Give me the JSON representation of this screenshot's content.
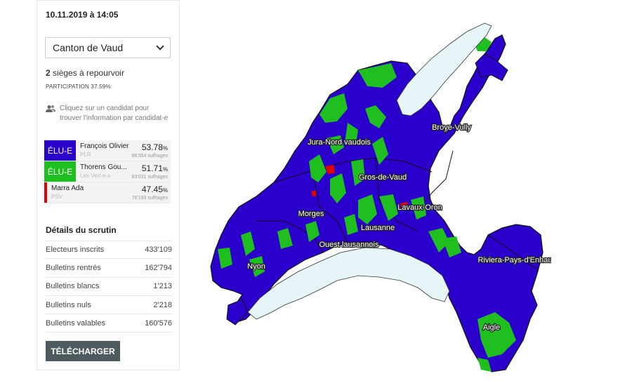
{
  "header": {
    "timestamp": "10.11.2019 à 14:05"
  },
  "selector": {
    "value": "Canton de Vaud"
  },
  "summary": {
    "seats_count": "2",
    "seats_text": " sièges à repourvoir",
    "participation": "PARTICIPATION 37.59%"
  },
  "hint": {
    "text": "Cliquez sur un candidat pour trouver l'information par candidat-e"
  },
  "candidates": [
    {
      "badge": "ÉLU-E",
      "name": "François Olivier",
      "party": "PLR",
      "pct": "53.78",
      "pct_unit": "%",
      "votes": "86'354 suffrages",
      "color": "#2b00cc"
    },
    {
      "badge": "ÉLU-E",
      "name": "Thorens Gou...",
      "party": "Les Vert-e-s",
      "pct": "51.71",
      "pct_unit": "%",
      "votes": "83'031 suffrages",
      "color": "#1fbf1f"
    },
    {
      "badge": "",
      "name": "Marra Ada",
      "party": "PSV",
      "pct": "47.45",
      "pct_unit": "%",
      "votes": "76'193 suffrages",
      "color": "#e00000"
    }
  ],
  "details": {
    "title": "Détails du scrutin",
    "rows": [
      {
        "label": "Electeurs inscrits",
        "value": "433'109"
      },
      {
        "label": "Bulletins rentrés",
        "value": "162'794"
      },
      {
        "label": "Bulletins blancs",
        "value": "1'213"
      },
      {
        "label": "Bulletins nuls",
        "value": "2'218"
      },
      {
        "label": "Bulletins valables",
        "value": "160'576"
      }
    ]
  },
  "download": {
    "label": "TÉLÉCHARGER"
  },
  "map": {
    "colors": {
      "plr": "#2b00cc",
      "verts": "#1fbf1f",
      "psv": "#e00000",
      "lake": "#e6f6f8"
    },
    "districts": [
      {
        "name": "Jura-Nord vaudois"
      },
      {
        "name": "Broye-Vully"
      },
      {
        "name": "Gros-de-Vaud"
      },
      {
        "name": "Lavaux-Oron"
      },
      {
        "name": "Morges"
      },
      {
        "name": "Lausanne"
      },
      {
        "name": "Ouest lausannois"
      },
      {
        "name": "Riviera-Pays-d'Enhaut"
      },
      {
        "name": "Nyon"
      },
      {
        "name": "Aigle"
      }
    ]
  }
}
